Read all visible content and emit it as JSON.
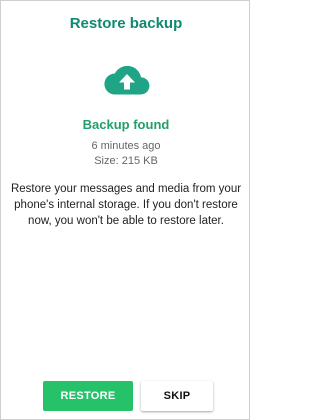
{
  "dialog": {
    "title": "Restore backup",
    "icon": "cloud-upload-icon",
    "status": "Backup found",
    "time_ago": "6 minutes ago",
    "size": "Size: 215 KB",
    "description": "Restore your messages and media from your phone's internal storage. If you don't restore now, you won't be able to restore later."
  },
  "buttons": {
    "restore_label": "RESTORE",
    "skip_label": "SKIP"
  },
  "colors": {
    "title": "#0e8a72",
    "cloud": "#1fa486",
    "status": "#22a06b",
    "restore_button": "#25c26a"
  }
}
